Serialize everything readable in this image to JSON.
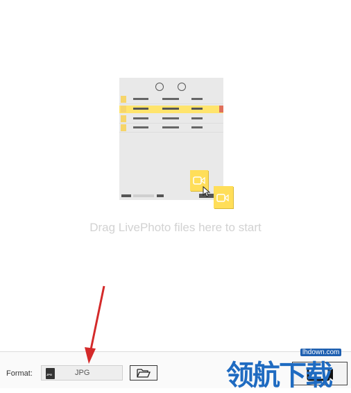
{
  "drop_zone": {
    "hint": "Drag LivePhoto files here to start"
  },
  "bottom_bar": {
    "format_label": "Format:",
    "format_value": "JPG",
    "format_icon_text": "JPG"
  },
  "watermark": {
    "url": "lhdown.com",
    "text": "领航下载"
  },
  "icons": {
    "format": "jpg-file-icon",
    "folder": "open-folder-icon",
    "convert": "convert-icon",
    "video": "video-camera-icon",
    "cursor": "mouse-cursor-icon",
    "annotation": "red-arrow-icon"
  },
  "colors": {
    "highlight": "#ffe46c",
    "card": "#ffde59",
    "arrow": "#d42a2a",
    "hint_text": "#d2d2d2",
    "watermark": "#1f6bc1"
  }
}
